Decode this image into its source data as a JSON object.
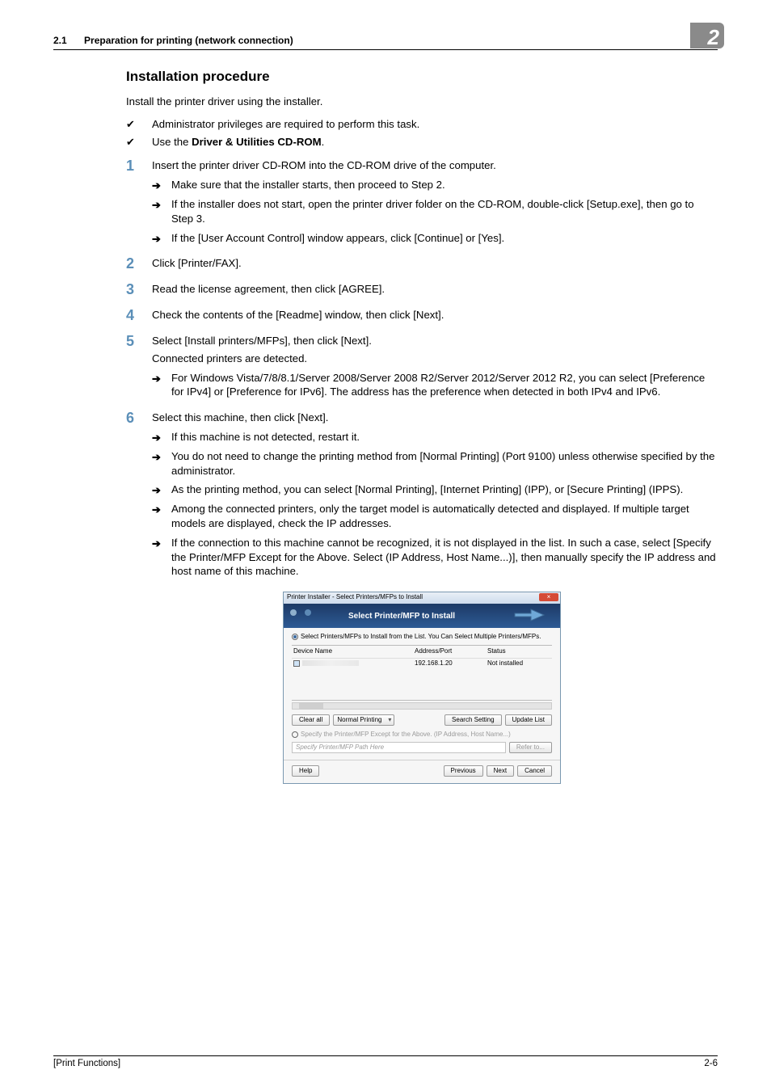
{
  "header": {
    "section_number": "2.1",
    "section_title": "Preparation for printing (network connection)",
    "chapter_number": "2"
  },
  "content": {
    "title": "Installation procedure",
    "intro": "Install the printer driver using the installer.",
    "prereqs": [
      {
        "text_plain": "Administrator privileges are required to perform this task."
      },
      {
        "text_prefix": "Use the ",
        "text_bold": "Driver & Utilities CD-ROM",
        "text_suffix": "."
      }
    ],
    "steps": [
      {
        "num": "1",
        "text": "Insert the printer driver CD-ROM into the CD-ROM drive of the computer.",
        "subs": [
          "Make sure that the installer starts, then proceed to Step 2.",
          "If the installer does not start, open the printer driver folder on the CD-ROM, double-click [Setup.exe], then go to Step 3.",
          "If the [User Account Control] window appears, click [Continue] or [Yes]."
        ]
      },
      {
        "num": "2",
        "text": "Click [Printer/FAX]."
      },
      {
        "num": "3",
        "text": "Read the license agreement, then click [AGREE]."
      },
      {
        "num": "4",
        "text": "Check the contents of the [Readme] window, then click [Next]."
      },
      {
        "num": "5",
        "text": "Select [Install printers/MFPs], then click [Next].",
        "note": "Connected printers are detected.",
        "subs": [
          "For Windows Vista/7/8/8.1/Server 2008/Server 2008 R2/Server 2012/Server 2012 R2, you can select [Preference for IPv4] or [Preference for IPv6]. The address has the preference when detected in both IPv4 and IPv6."
        ]
      },
      {
        "num": "6",
        "text": "Select this machine, then click [Next].",
        "subs": [
          "If this machine is not detected, restart it.",
          "You do not need to change the printing method from [Normal Printing] (Port 9100) unless otherwise specified by the administrator.",
          "As the printing method, you can select [Normal Printing], [Internet Printing] (IPP), or [Secure Printing] (IPPS).",
          "Among the connected printers, only the target model is automatically detected and displayed. If multiple target models are displayed, check the IP addresses.",
          "If the connection to this machine cannot be recognized, it is not displayed in the list. In such a case, select [Specify the Printer/MFP Except for the Above. Select (IP Address, Host Name...)], then manually specify the IP address and host name of this machine."
        ]
      }
    ]
  },
  "dialog": {
    "titlebar": "Printer Installer - Select Printers/MFPs to Install",
    "banner_title": "Select Printer/MFP to Install",
    "radio1": "Select Printers/MFPs to Install from the List. You Can Select Multiple Printers/MFPs.",
    "cols": {
      "c1": "Device Name",
      "c2": "Address/Port",
      "c3": "Status"
    },
    "row": {
      "addr": "192.168.1.20",
      "status": "Not installed"
    },
    "clear_all": "Clear all",
    "normal_printing": "Normal Printing",
    "search_setting": "Search Setting",
    "update_list": "Update List",
    "radio2": "Specify the Printer/MFP Except for the Above. (IP Address, Host Name...)",
    "path_placeholder": "Specify Printer/MFP Path Here",
    "refer_to": "Refer to...",
    "help": "Help",
    "previous": "Previous",
    "next": "Next",
    "cancel": "Cancel"
  },
  "footer": {
    "left": "[Print Functions]",
    "right": "2-6"
  }
}
